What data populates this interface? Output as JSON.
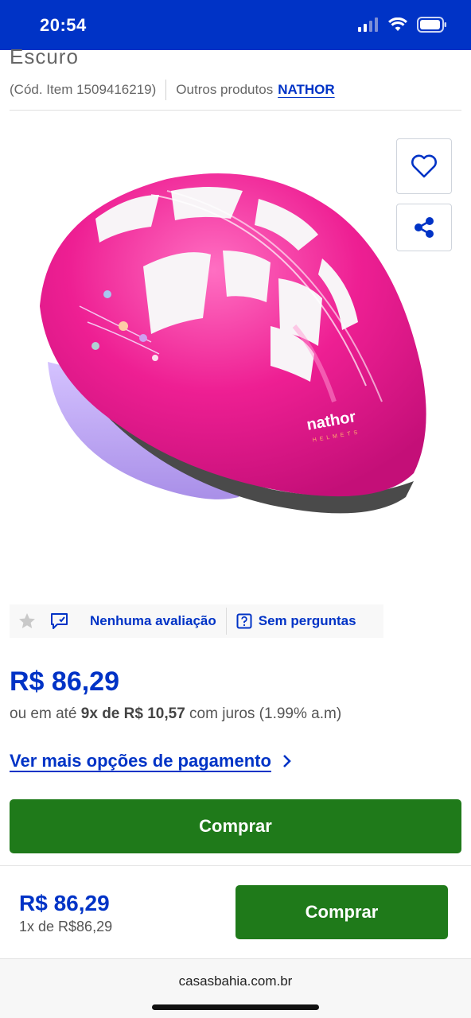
{
  "status_bar": {
    "time": "20:54"
  },
  "product": {
    "title_tail": "Escuro",
    "item_code": "(Cód. Item 1509416219)",
    "other_products_label": "Outros produtos",
    "brand": "NATHOR",
    "image_alt": "nathor",
    "image_logo_text": "nathor",
    "image_logo_sub": "HELMETS"
  },
  "actions": {
    "favorite_icon": "heart-icon",
    "share_icon": "share-icon"
  },
  "rating": {
    "star_icon": "star-icon",
    "reviews_label": "Nenhuma avaliação",
    "questions_label": "Sem perguntas"
  },
  "pricing": {
    "price": "R$ 86,29",
    "installments_prefix": "ou em até",
    "installments_bold": "9x de R$ 10,57",
    "installments_suffix": "com juros (1.99% a.m)",
    "more_payment_options": "Ver mais opções de pagamento"
  },
  "buy_button_label": "Comprar",
  "sticky": {
    "price": "R$ 86,29",
    "installment_text": "1x de R$86,29",
    "buy_button_label": "Comprar"
  },
  "browser": {
    "url": "casasbahia.com.br"
  },
  "colors": {
    "brand_blue": "#0033c6",
    "buy_green": "#1f7a1a",
    "helmet_pink": "#e8188a",
    "helmet_lilac": "#b9a0f0"
  }
}
